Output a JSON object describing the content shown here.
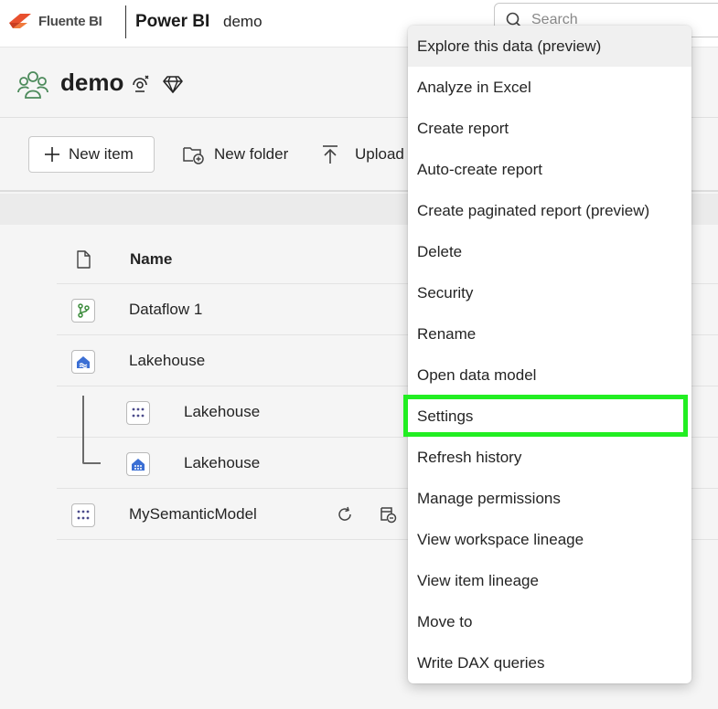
{
  "topbar": {
    "brand_name": "Fluente BI",
    "product": "Power BI",
    "workspace_crumb": "demo",
    "search_placeholder": "Search"
  },
  "workspace": {
    "title": "demo"
  },
  "toolbar": {
    "new_item": "New item",
    "new_folder": "New folder",
    "upload": "Upload"
  },
  "table": {
    "header_name": "Name",
    "rows": [
      {
        "name": "Dataflow 1",
        "icon": "dataflow-icon"
      },
      {
        "name": "Lakehouse",
        "icon": "lakehouse-icon"
      },
      {
        "name": "Lakehouse",
        "icon": "semantic-model-icon"
      },
      {
        "name": "Lakehouse",
        "icon": "sql-endpoint-icon"
      },
      {
        "name": "MySemanticModel",
        "icon": "semantic-model-icon"
      }
    ]
  },
  "context_menu": {
    "items": [
      "Explore this data (preview)",
      "Analyze in Excel",
      "Create report",
      "Auto-create report",
      "Create paginated report (preview)",
      "Delete",
      "Security",
      "Rename",
      "Open data model",
      "Settings",
      "Refresh history",
      "Manage permissions",
      "View workspace lineage",
      "View item lineage",
      "Move to",
      "Write DAX queries"
    ],
    "highlighted_item": "Settings",
    "highlight_color": "#22ee22"
  },
  "colors": {
    "brand_orange": "#e8502e",
    "workspace_green": "#4c8a5b",
    "lakehouse_blue": "#3b6fd4"
  }
}
